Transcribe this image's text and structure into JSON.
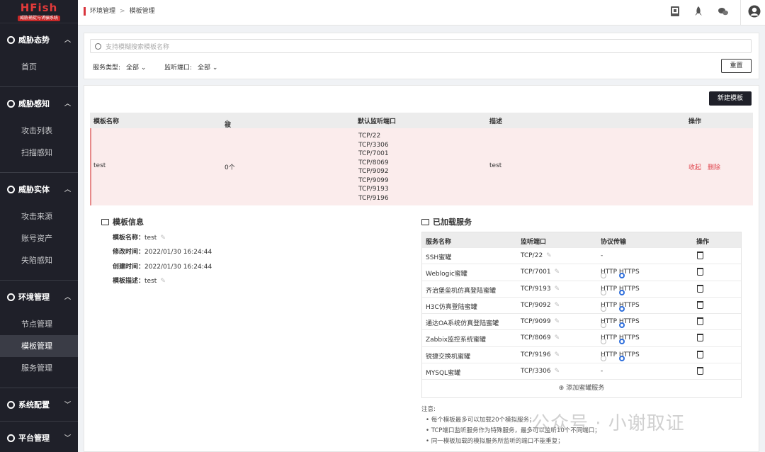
{
  "brand": {
    "title": "HFish",
    "subtitle": "威胁捕捉与诱骗系统"
  },
  "sidebar": [
    {
      "label": "威胁态势",
      "items": [
        "首页"
      ]
    },
    {
      "label": "威胁感知",
      "items": [
        "攻击列表",
        "扫描感知"
      ]
    },
    {
      "label": "威胁实体",
      "items": [
        "攻击来源",
        "账号资产",
        "失陷感知"
      ]
    },
    {
      "label": "环境管理",
      "items": [
        "节点管理",
        "模板管理",
        "服务管理"
      ]
    },
    {
      "label": "系统配置",
      "items": []
    },
    {
      "label": "平台管理",
      "items": []
    }
  ],
  "active_item": "模板管理",
  "breadcrumb": {
    "parent": "环境管理",
    "separator": ">",
    "current": "模板管理"
  },
  "filter": {
    "search_placeholder": "支持模糊搜索模板名称",
    "service_type_label": "服务类型:",
    "service_type_value": "全部",
    "port_label": "监听端口:",
    "port_value": "全部",
    "reset": "重置"
  },
  "new_template": "新建模板",
  "table": {
    "headers": {
      "name": "模板名称",
      "refs": "被节点引用数",
      "ports": "默认监听端口",
      "desc": "描述",
      "ops": "操作"
    },
    "sort_icon": "⇕",
    "row": {
      "name": "test",
      "refs": "0个",
      "ports": [
        "TCP/22",
        "TCP/3306",
        "TCP/7001",
        "TCP/8069",
        "TCP/9092",
        "TCP/9099",
        "TCP/9193",
        "TCP/9196"
      ],
      "desc": "test",
      "collapse": "收起",
      "delete": "删除"
    }
  },
  "info": {
    "title": "模板信息",
    "name_label": "模板名称：",
    "name": "test",
    "mtime_label": "修改时间：",
    "mtime": "2022/01/30 16:24:44",
    "ctime_label": "创建时间：",
    "ctime": "2022/01/30 16:24:44",
    "desc_label": "模板描述：",
    "desc": "test"
  },
  "services": {
    "title": "已加载服务",
    "headers": {
      "name": "服务名称",
      "port": "监听端口",
      "proto": "协议传输",
      "ops": "操作"
    },
    "http": "HTTP",
    "https": "HTTPS",
    "rows": [
      {
        "name": "SSH蜜罐",
        "port": "TCP/22",
        "proto": "-"
      },
      {
        "name": "Weblogic蜜罐",
        "port": "TCP/7001",
        "proto": "https"
      },
      {
        "name": "齐治堡垒机仿真登陆蜜罐",
        "port": "TCP/9193",
        "proto": "https"
      },
      {
        "name": "H3C仿真登陆蜜罐",
        "port": "TCP/9092",
        "proto": "https"
      },
      {
        "name": "通达OA系统仿真登陆蜜罐",
        "port": "TCP/9099",
        "proto": "https"
      },
      {
        "name": "Zabbix监控系统蜜罐",
        "port": "TCP/8069",
        "proto": "https"
      },
      {
        "name": "锐捷交换机蜜罐",
        "port": "TCP/9196",
        "proto": "https"
      },
      {
        "name": "MYSQL蜜罐",
        "port": "TCP/3306",
        "proto": "-"
      }
    ],
    "add": "添加蜜罐服务"
  },
  "notes": {
    "title": "注意:",
    "items": [
      "每个模板最多可以加载20个模拟服务；",
      "TCP端口监听服务作为特殊服务，最多可以监听10个不同端口；",
      "同一模板加载的模拟服务所监听的端口不能重复；"
    ]
  },
  "watermark": "公众号 · 小谢取证"
}
